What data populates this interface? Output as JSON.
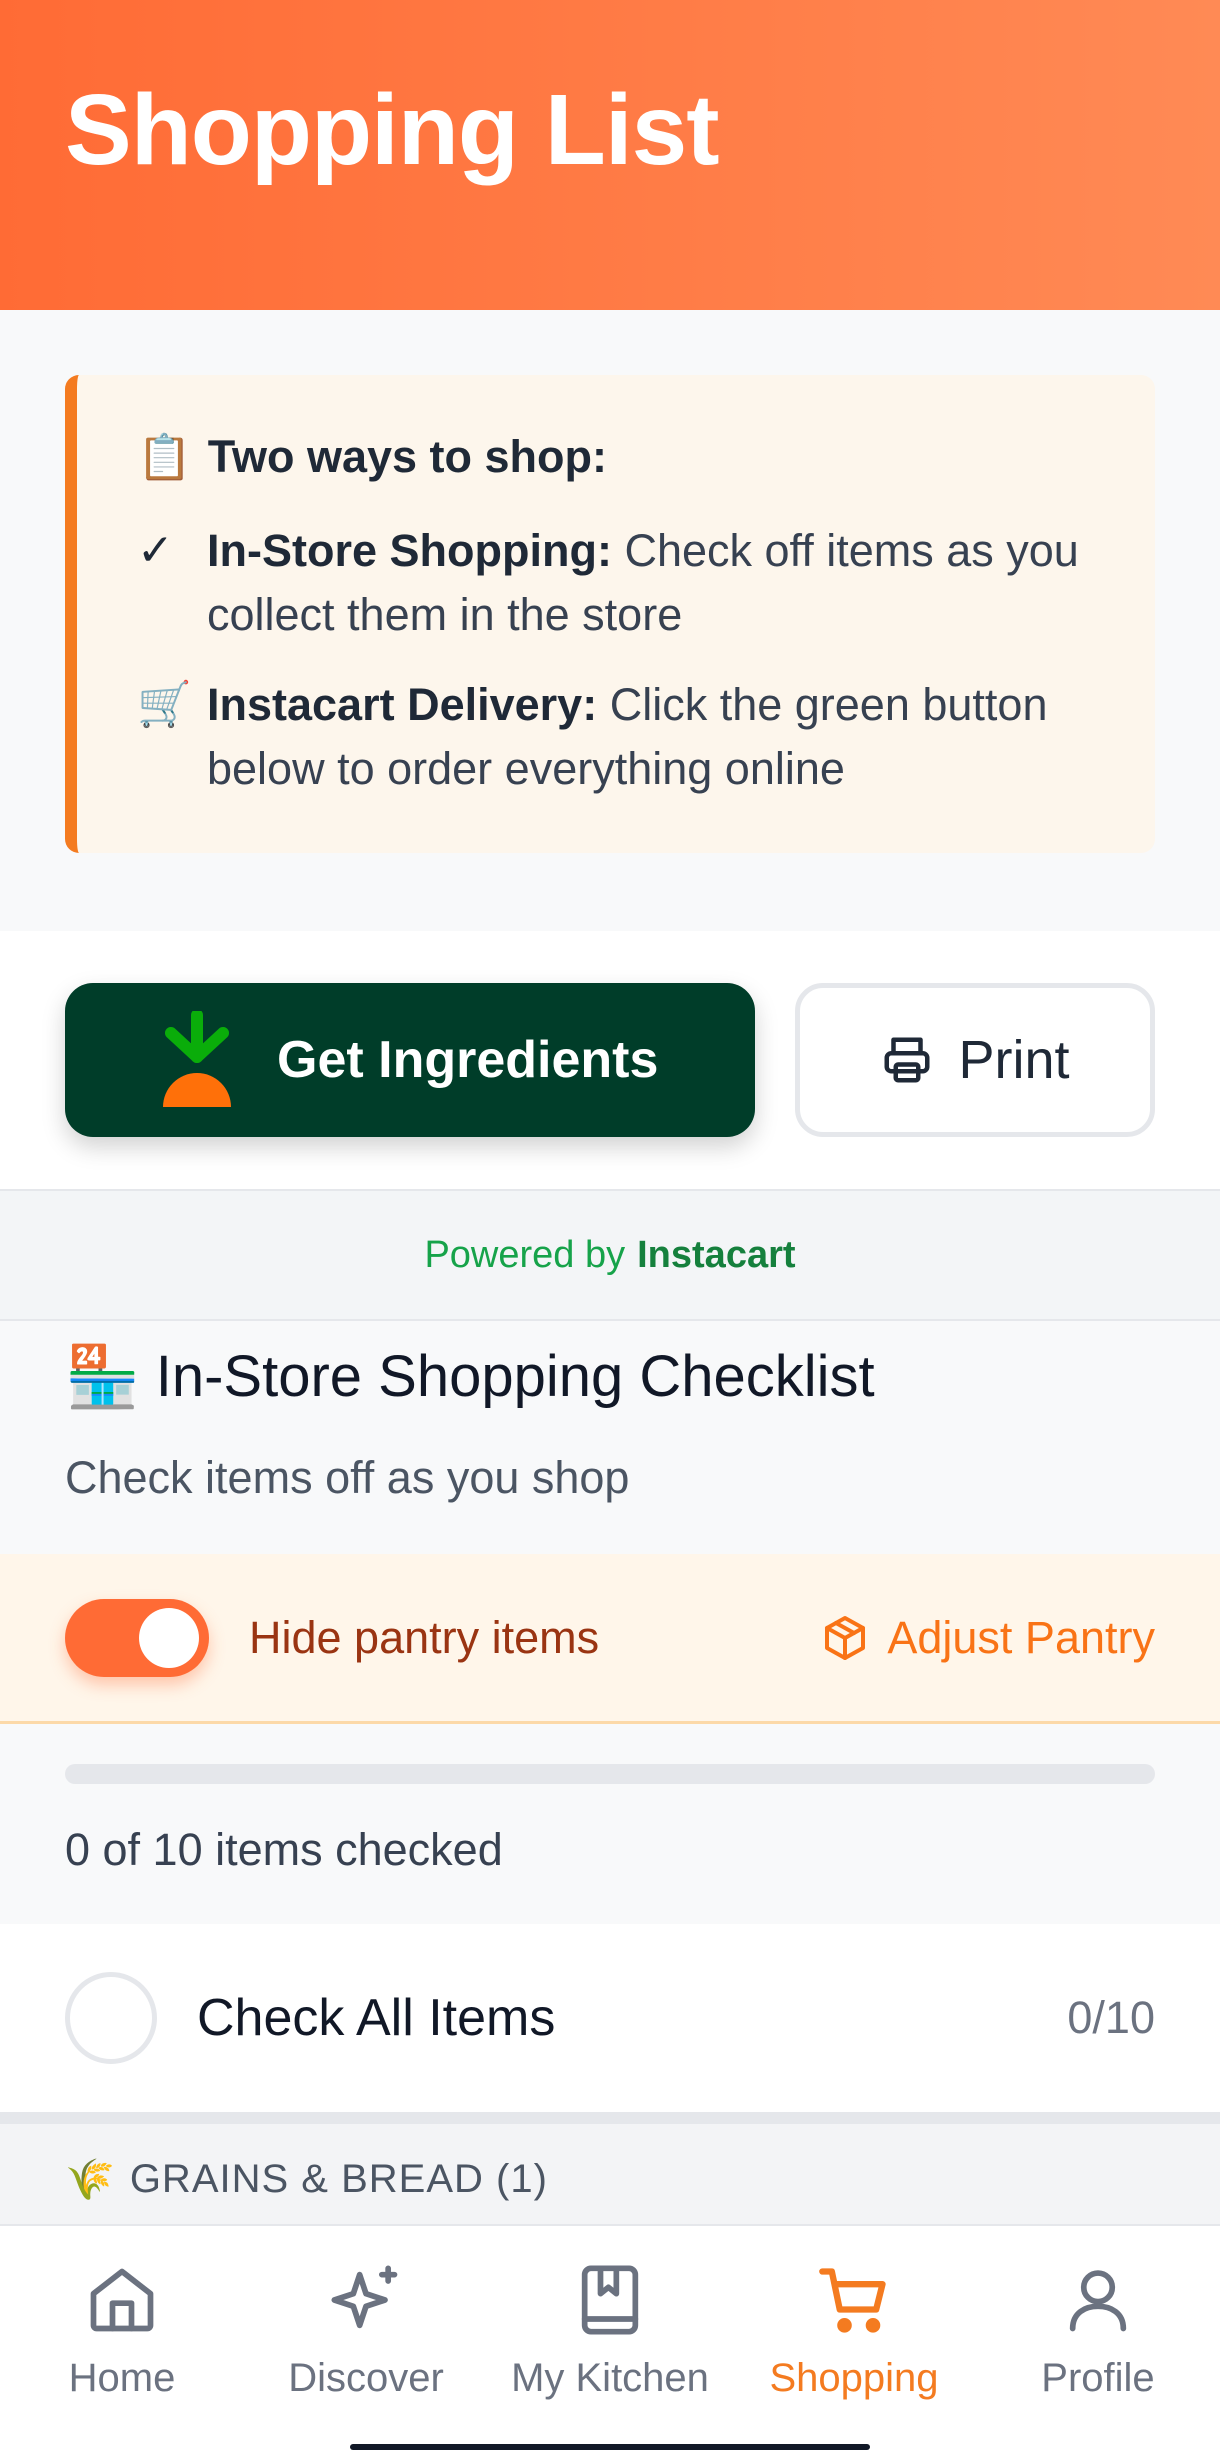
{
  "header": {
    "title": "Shopping List"
  },
  "info": {
    "title_emoji": "📋",
    "title": "Two ways to shop:",
    "instore_glyph": "✓",
    "instore_bold": "In-Store Shopping:",
    "instore_text": " Check off items as you collect them in the store",
    "delivery_glyph": "🛒",
    "delivery_bold": "Instacart Delivery:",
    "delivery_text": " Click the green button below to order everything online"
  },
  "actions": {
    "ingredients_label": "Get Ingredients",
    "print_label": "Print"
  },
  "powered": {
    "prefix": "Powered by",
    "brand": "Instacart"
  },
  "checklist": {
    "emoji": "🏪",
    "title": "In-Store Shopping Checklist",
    "subtitle": "Check items off as you shop"
  },
  "pantry": {
    "toggle_on": true,
    "label": "Hide pantry items",
    "adjust_label": "Adjust Pantry"
  },
  "progress": {
    "fraction": 0,
    "text": "0 of 10 items checked"
  },
  "check_all": {
    "label": "Check All Items",
    "count": "0/10"
  },
  "category": {
    "emoji": "🌾",
    "label": "GRAINS & BREAD (1)"
  },
  "nav": {
    "items": [
      {
        "label": "Home",
        "icon": "home-icon"
      },
      {
        "label": "Discover",
        "icon": "sparkle-icon"
      },
      {
        "label": "My Kitchen",
        "icon": "book-icon"
      },
      {
        "label": "Shopping",
        "icon": "cart-icon",
        "active": true
      },
      {
        "label": "Profile",
        "icon": "user-icon"
      }
    ]
  },
  "colors": {
    "brand_orange": "#ff6b35",
    "instacart_green": "#003d29",
    "active_nav": "#f47b20"
  }
}
